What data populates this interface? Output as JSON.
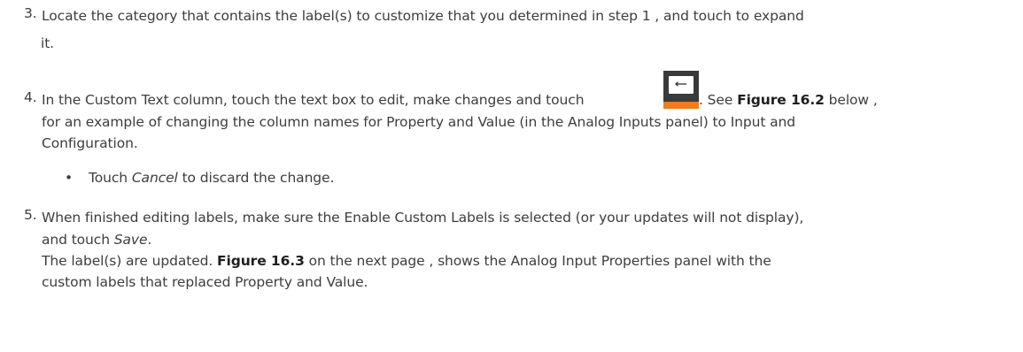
{
  "steps": [
    {
      "num": "3.",
      "line1": "Locate the category that contains the label(s) to customize that you determined in step  1 , and touch to expand",
      "line2": "it."
    },
    {
      "num": "4.",
      "pre_icon": "In the Custom Text column, touch the text box to edit, make changes and touch",
      "post_icon": ". See ",
      "figure_ref": "Figure 16.2",
      "after_ref": "  below ,",
      "line2": "for an example of changing the column names for Property and Value (in the Analog Inputs panel) to Input and",
      "line3": "Configuration.",
      "icon": "enter-key-icon"
    },
    {
      "num": "5.",
      "line1_a": "When finished editing labels, make sure the Enable Custom Labels is selected (or your updates will not display),",
      "line2_a": "and touch ",
      "line2_ital": "Save",
      "line2_end": ".",
      "line3_a": "The label(s) are updated. ",
      "line3_ref": "Figure 16.3",
      "line3_b": "  on the next page , shows the Analog Input Properties panel with the",
      "line4": "custom labels that replaced Property and Value."
    }
  ],
  "bullet": {
    "symbol": "•",
    "pre": "Touch ",
    "ital": "Cancel",
    "post": " to discard the change."
  },
  "colors": {
    "text": "#3d3d3d",
    "icon_dark": "#3a3a3a",
    "icon_accent": "#f07c1c"
  }
}
